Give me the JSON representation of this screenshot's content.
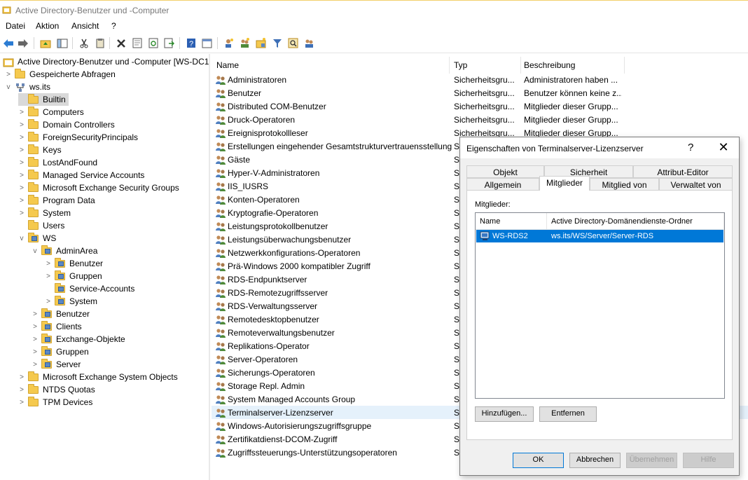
{
  "window": {
    "title": "Active Directory-Benutzer und -Computer"
  },
  "menu": [
    "Datei",
    "Aktion",
    "Ansicht",
    "?"
  ],
  "toolbar_icons": [
    "back-arrow-icon",
    "forward-arrow-icon",
    "folder-up-icon",
    "show-tree-icon",
    "cut-icon",
    "clipboard-icon",
    "delete-icon",
    "properties-icon",
    "refresh-icon",
    "export-icon",
    "help-icon",
    "console-icon",
    "user-icon",
    "group-icon",
    "ou-icon",
    "filter-icon",
    "find-icon",
    "add-to-group-icon"
  ],
  "tree": {
    "root": "Active Directory-Benutzer und -Computer [WS-DC1",
    "saved_queries": "Gespeicherte Abfragen",
    "domain": "ws.its",
    "items": [
      {
        "label": "Builtin",
        "level": 2,
        "chev": "",
        "selected": true
      },
      {
        "label": "Computers",
        "level": 2,
        "chev": ">"
      },
      {
        "label": "Domain Controllers",
        "level": 2,
        "chev": ">"
      },
      {
        "label": "ForeignSecurityPrincipals",
        "level": 2,
        "chev": ">"
      },
      {
        "label": "Keys",
        "level": 2,
        "chev": ">"
      },
      {
        "label": "LostAndFound",
        "level": 2,
        "chev": ">"
      },
      {
        "label": "Managed Service Accounts",
        "level": 2,
        "chev": ">"
      },
      {
        "label": "Microsoft Exchange Security Groups",
        "level": 2,
        "chev": ">"
      },
      {
        "label": "Program Data",
        "level": 2,
        "chev": ">"
      },
      {
        "label": "System",
        "level": 2,
        "chev": ">"
      },
      {
        "label": "Users",
        "level": 2,
        "chev": ""
      },
      {
        "label": "WS",
        "level": 2,
        "chev": "v",
        "ou": true
      },
      {
        "label": "AdminArea",
        "level": 3,
        "chev": "v",
        "ou": true
      },
      {
        "label": "Benutzer",
        "level": 4,
        "chev": ">",
        "ou": true
      },
      {
        "label": "Gruppen",
        "level": 4,
        "chev": ">",
        "ou": true
      },
      {
        "label": "Service-Accounts",
        "level": 4,
        "chev": "",
        "ou": true
      },
      {
        "label": "System",
        "level": 4,
        "chev": ">",
        "ou": true
      },
      {
        "label": "Benutzer",
        "level": 3,
        "chev": ">",
        "ou": true
      },
      {
        "label": "Clients",
        "level": 3,
        "chev": ">",
        "ou": true
      },
      {
        "label": "Exchange-Objekte",
        "level": 3,
        "chev": ">",
        "ou": true
      },
      {
        "label": "Gruppen",
        "level": 3,
        "chev": ">",
        "ou": true
      },
      {
        "label": "Server",
        "level": 3,
        "chev": ">",
        "ou": true
      },
      {
        "label": "Microsoft Exchange System Objects",
        "level": 2,
        "chev": ">"
      },
      {
        "label": "NTDS Quotas",
        "level": 2,
        "chev": ">"
      },
      {
        "label": "TPM Devices",
        "level": 2,
        "chev": ">"
      }
    ]
  },
  "list": {
    "columns": [
      "Name",
      "Typ",
      "Beschreibung"
    ],
    "rows": [
      {
        "name": "Administratoren",
        "typ": "Sicherheitsgru...",
        "desc": "Administratoren haben ..."
      },
      {
        "name": "Benutzer",
        "typ": "Sicherheitsgru...",
        "desc": "Benutzer können keine z..."
      },
      {
        "name": "Distributed COM-Benutzer",
        "typ": "Sicherheitsgru...",
        "desc": "Mitglieder dieser Grupp..."
      },
      {
        "name": "Druck-Operatoren",
        "typ": "Sicherheitsgru...",
        "desc": "Mitglieder dieser Grupp..."
      },
      {
        "name": "Ereignisprotokollleser",
        "typ": "Sicherheitsgru...",
        "desc": "Mitglieder dieser Grupp..."
      },
      {
        "name": "Erstellungen eingehender Gesamtstrukturvertrauensstellung",
        "typ": "Si",
        "desc": ""
      },
      {
        "name": "Gäste",
        "typ": "Si",
        "desc": ""
      },
      {
        "name": "Hyper-V-Administratoren",
        "typ": "Si",
        "desc": ""
      },
      {
        "name": "IIS_IUSRS",
        "typ": "Si",
        "desc": ""
      },
      {
        "name": "Konten-Operatoren",
        "typ": "Si",
        "desc": ""
      },
      {
        "name": "Kryptografie-Operatoren",
        "typ": "Si",
        "desc": ""
      },
      {
        "name": "Leistungsprotokollbenutzer",
        "typ": "Si",
        "desc": ""
      },
      {
        "name": "Leistungsüberwachungsbenutzer",
        "typ": "Si",
        "desc": ""
      },
      {
        "name": "Netzwerkkonfigurations-Operatoren",
        "typ": "Si",
        "desc": ""
      },
      {
        "name": "Prä-Windows 2000 kompatibler Zugriff",
        "typ": "Si",
        "desc": ""
      },
      {
        "name": "RDS-Endpunktserver",
        "typ": "Si",
        "desc": ""
      },
      {
        "name": "RDS-Remotezugriffsserver",
        "typ": "Si",
        "desc": ""
      },
      {
        "name": "RDS-Verwaltungsserver",
        "typ": "Si",
        "desc": ""
      },
      {
        "name": "Remotedesktopbenutzer",
        "typ": "Si",
        "desc": ""
      },
      {
        "name": "Remoteverwaltungsbenutzer",
        "typ": "Si",
        "desc": ""
      },
      {
        "name": "Replikations-Operator",
        "typ": "Si",
        "desc": ""
      },
      {
        "name": "Server-Operatoren",
        "typ": "Si",
        "desc": ""
      },
      {
        "name": "Sicherungs-Operatoren",
        "typ": "Si",
        "desc": ""
      },
      {
        "name": "Storage Repl. Admin",
        "typ": "Si",
        "desc": ""
      },
      {
        "name": "System Managed Accounts Group",
        "typ": "Si",
        "desc": ""
      },
      {
        "name": "Terminalserver-Lizenzserver",
        "typ": "Si",
        "desc": "",
        "highlighted": true
      },
      {
        "name": "Windows-Autorisierungszugriffsgruppe",
        "typ": "Si",
        "desc": ""
      },
      {
        "name": "Zertifikatdienst-DCOM-Zugriff",
        "typ": "Si",
        "desc": ""
      },
      {
        "name": "Zugriffssteuerungs-Unterstützungsoperatoren",
        "typ": "Si",
        "desc": ""
      }
    ]
  },
  "dialog": {
    "title": "Eigenschaften von Terminalserver-Lizenzserver",
    "help": "?",
    "close": "✕",
    "tabs_row1": [
      "Objekt",
      "Sicherheit",
      "Attribut-Editor"
    ],
    "tabs_row2": [
      "Allgemein",
      "Mitglieder",
      "Mitglied von",
      "Verwaltet von"
    ],
    "active_tab": "Mitglieder",
    "members_label": "Mitglieder:",
    "members_columns": [
      "Name",
      "Active Directory-Domänendienste-Ordner"
    ],
    "members": [
      {
        "name": "WS-RDS2",
        "folder": "ws.its/WS/Server/Server-RDS"
      }
    ],
    "buttons": {
      "add": "Hinzufügen...",
      "remove": "Entfernen",
      "ok": "OK",
      "cancel": "Abbrechen",
      "apply": "Übernehmen",
      "help": "Hilfe"
    }
  },
  "colors": {
    "accent": "#0078d7",
    "folder": "#f5c94e",
    "row_highlight": "#e5f1fb"
  }
}
